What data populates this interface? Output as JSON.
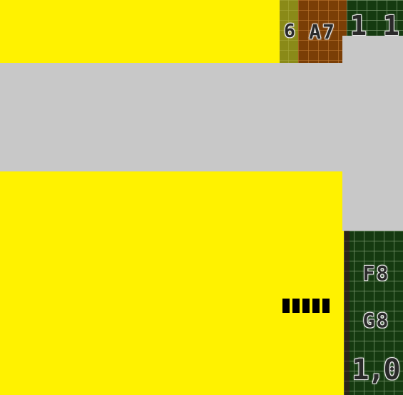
{
  "colors": {
    "overlay_yellow": "#fff200",
    "panel_gray": "#c8c8c8",
    "cell_green": "#153a10",
    "cell_brown": "#7a3e06",
    "cell_olive": "#8a8a18",
    "progress_segment": "#000000"
  },
  "map": {
    "cells": [
      {
        "label": "6"
      },
      {
        "label": "A7"
      },
      {
        "label": "1 1"
      },
      {
        "label": "F8"
      },
      {
        "label": "G8"
      },
      {
        "label": "1,0"
      }
    ]
  },
  "progress": {
    "segments_filled": 5
  }
}
